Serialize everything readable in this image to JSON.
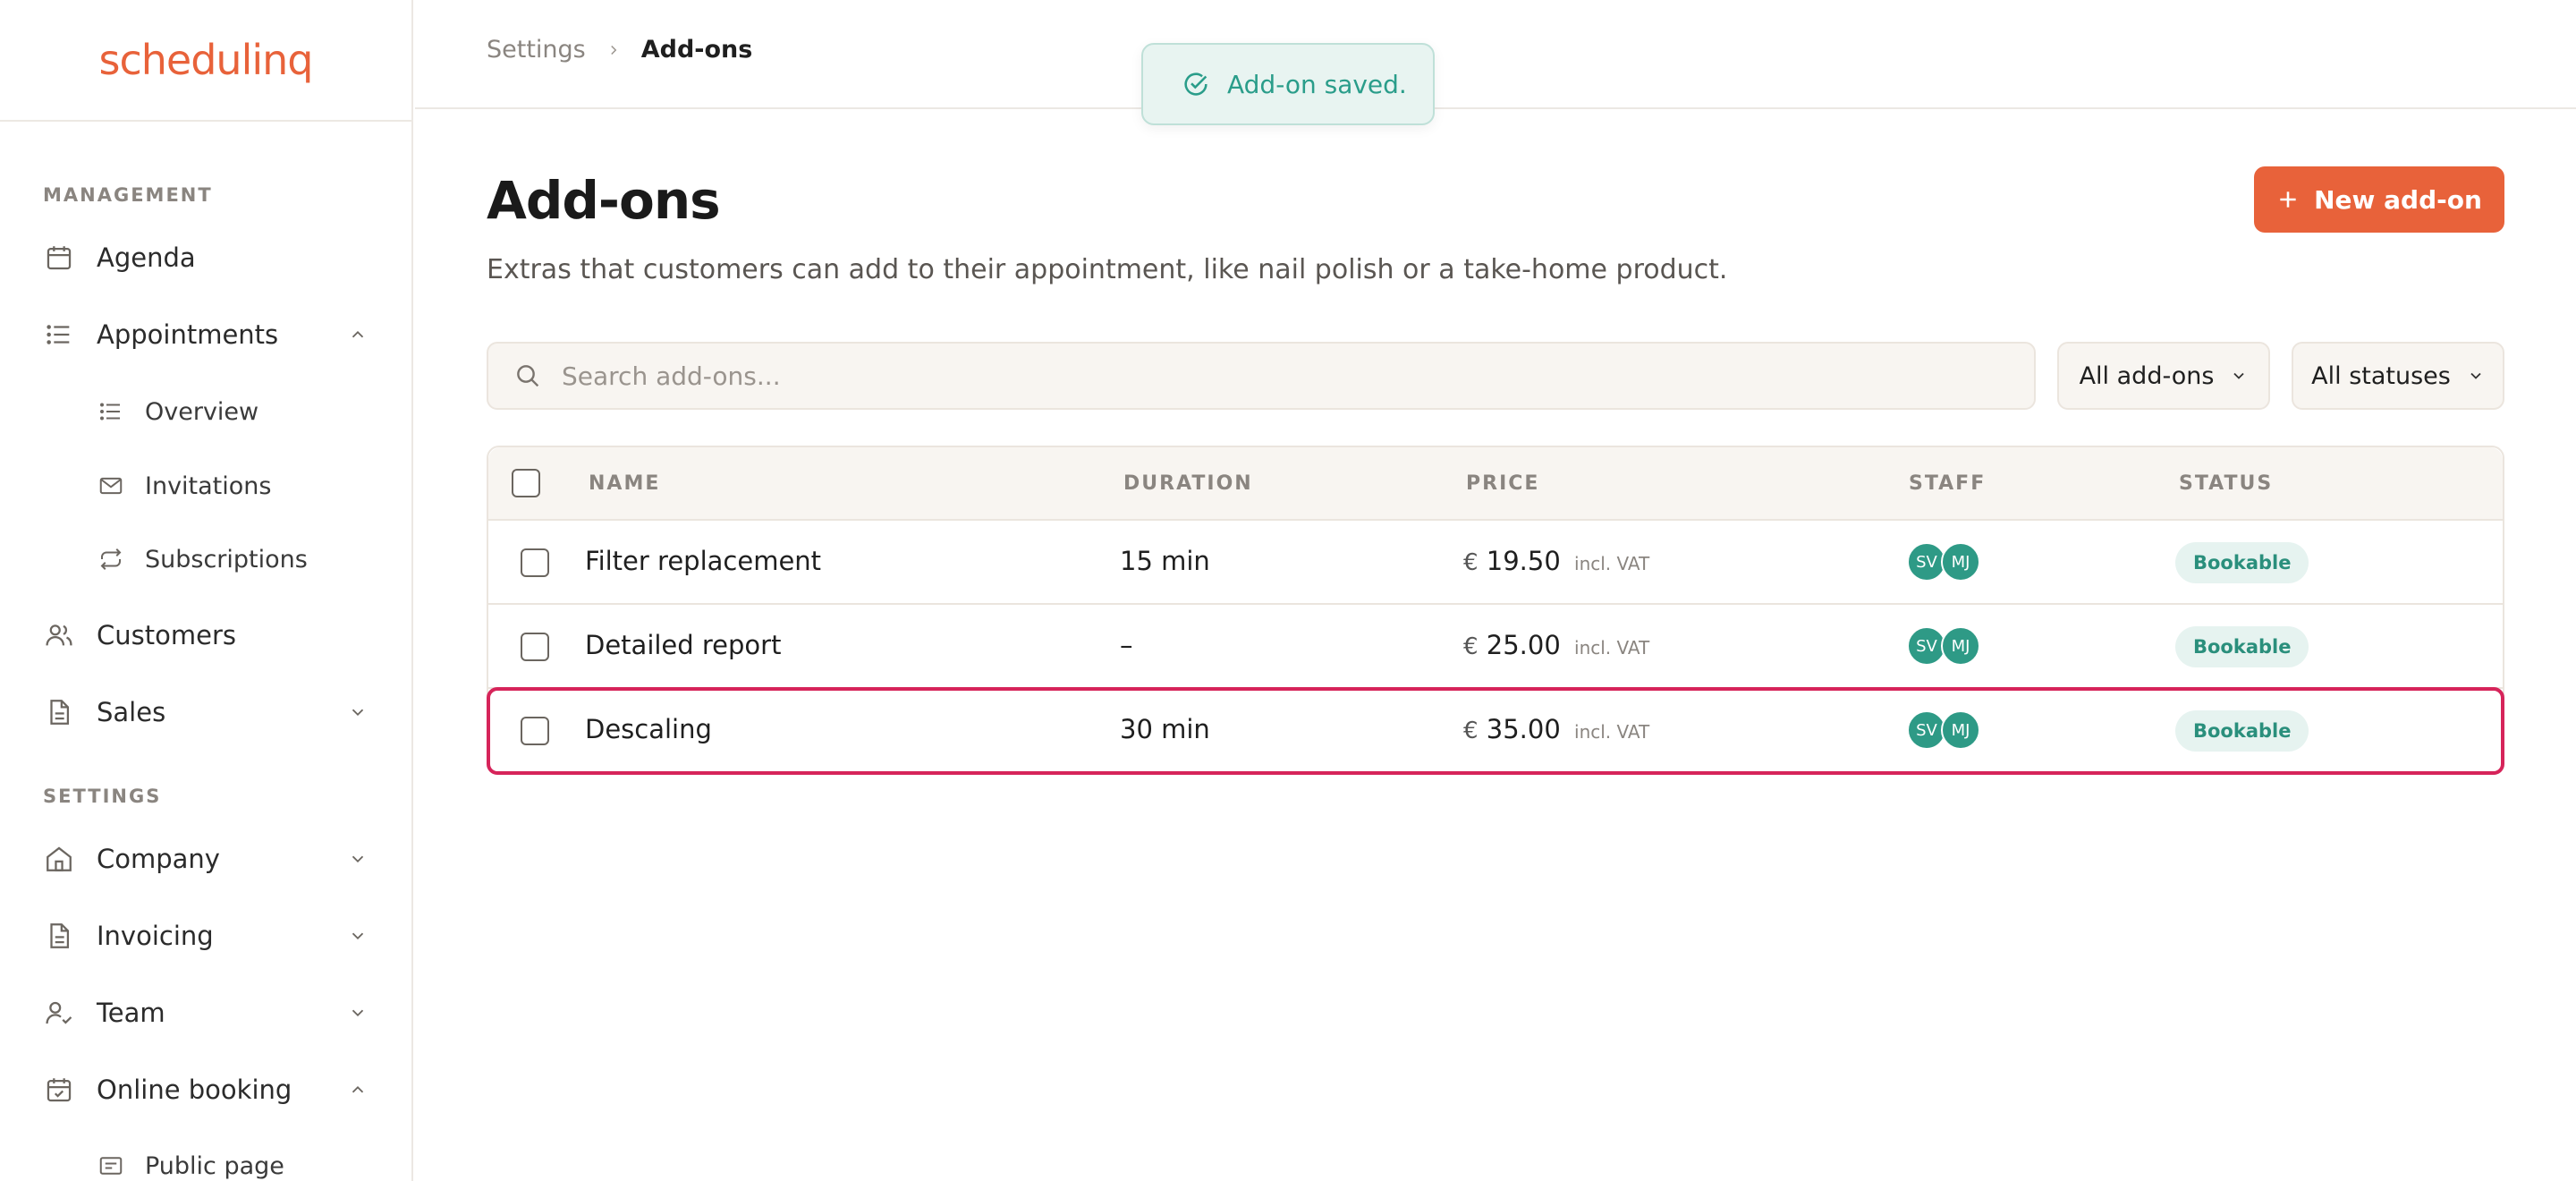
{
  "sidebar": {
    "logo": "schedulinq",
    "sections": {
      "management": "MANAGEMENT",
      "settings": "SETTINGS"
    },
    "items": [
      {
        "label": "Agenda",
        "icon": "calendar-icon"
      },
      {
        "label": "Appointments",
        "icon": "list-icon",
        "expanded": true
      },
      {
        "label": "Overview",
        "icon": "list-icon"
      },
      {
        "label": "Invitations",
        "icon": "mail-icon"
      },
      {
        "label": "Subscriptions",
        "icon": "repeat-icon"
      },
      {
        "label": "Customers",
        "icon": "users-icon"
      },
      {
        "label": "Sales",
        "icon": "document-icon"
      },
      {
        "label": "Company",
        "icon": "home-icon"
      },
      {
        "label": "Invoicing",
        "icon": "document-icon"
      },
      {
        "label": "Team",
        "icon": "user-check-icon"
      },
      {
        "label": "Online booking",
        "icon": "calendar-check-icon",
        "expanded": true
      },
      {
        "label": "Public page",
        "icon": "card-icon"
      }
    ]
  },
  "breadcrumb": {
    "parent": "Settings",
    "current": "Add-ons"
  },
  "toast": {
    "message": "Add-on saved."
  },
  "page": {
    "title": "Add-ons",
    "description": "Extras that customers can add to their appointment, like nail polish or a take-home product.",
    "new_button": "New add-on"
  },
  "search": {
    "placeholder": "Search add-ons..."
  },
  "filters": {
    "type": "All add-ons",
    "status": "All statuses"
  },
  "table": {
    "headers": {
      "name": "NAME",
      "duration": "DURATION",
      "price": "PRICE",
      "staff": "STAFF",
      "status": "STATUS"
    },
    "rows": [
      {
        "name": "Filter replacement",
        "duration": "15 min",
        "currency": "€",
        "price": "19.50",
        "vat": "incl. VAT",
        "staff": [
          "SV",
          "MJ"
        ],
        "status": "Bookable"
      },
      {
        "name": "Detailed report",
        "duration": "–",
        "currency": "€",
        "price": "25.00",
        "vat": "incl. VAT",
        "staff": [
          "SV",
          "MJ"
        ],
        "status": "Bookable"
      },
      {
        "name": "Descaling",
        "duration": "30 min",
        "currency": "€",
        "price": "35.00",
        "vat": "incl. VAT",
        "staff": [
          "SV",
          "MJ"
        ],
        "status": "Bookable"
      }
    ]
  },
  "colors": {
    "brand": "#e8623a",
    "accent_teal": "#2e9a86",
    "highlight": "#d6245a"
  }
}
